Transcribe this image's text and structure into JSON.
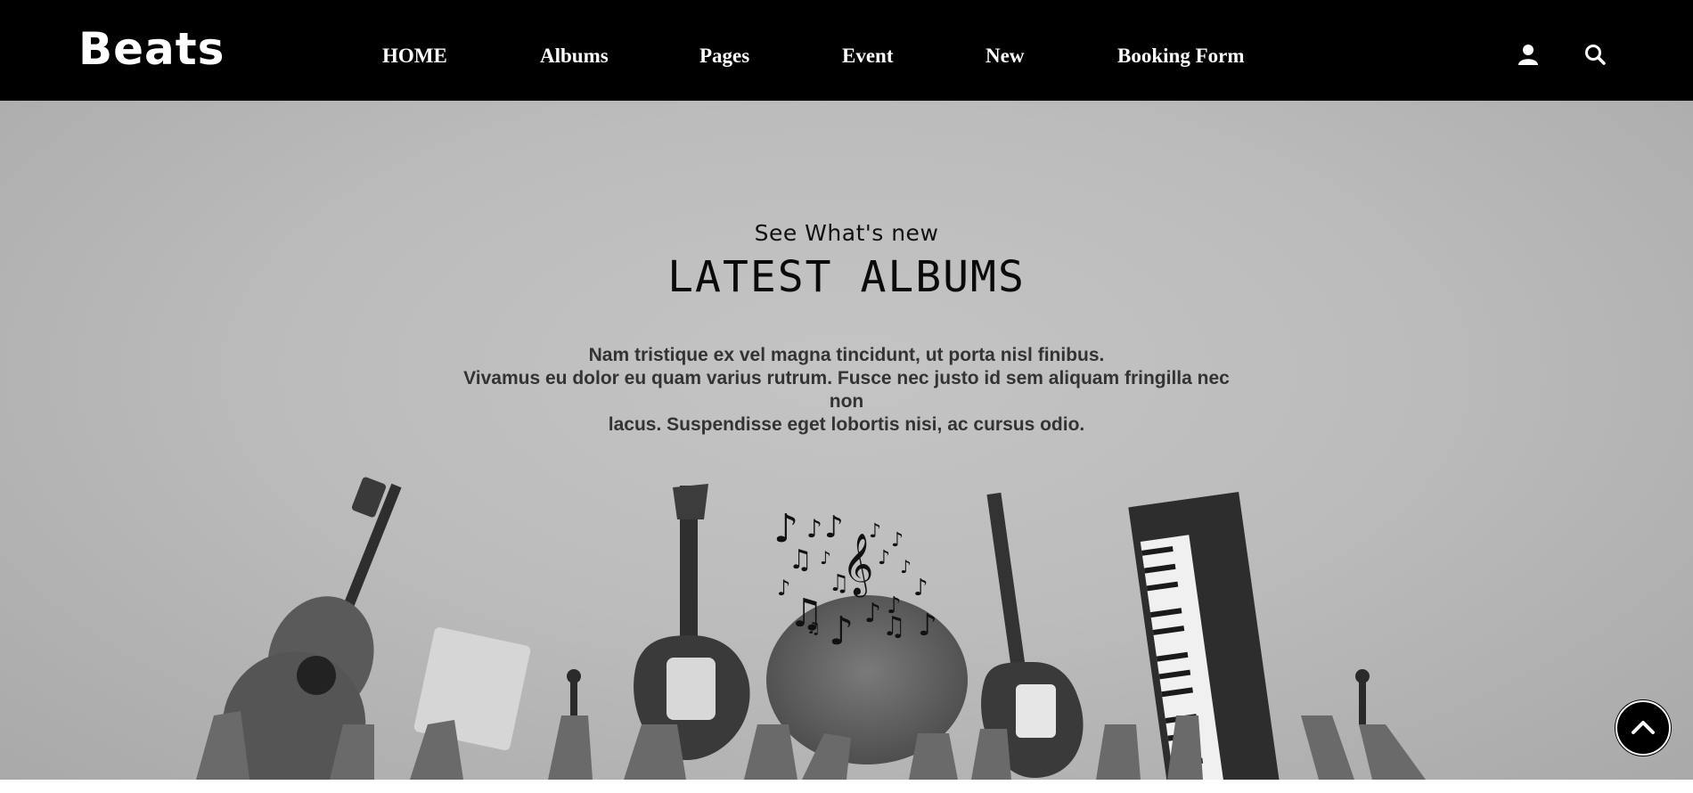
{
  "brand": {
    "name": "Beats"
  },
  "nav": {
    "items": [
      {
        "label": "HOME"
      },
      {
        "label": "Albums"
      },
      {
        "label": "Pages"
      },
      {
        "label": "Event"
      },
      {
        "label": "New"
      },
      {
        "label": "Booking Form"
      }
    ],
    "icons": {
      "user": "user-icon",
      "search": "search-icon"
    }
  },
  "hero": {
    "subtitle": "See What's new",
    "title": "LATEST ALBUMS",
    "description": [
      "Nam tristique ex vel magna tincidunt, ut porta nisl finibus.",
      "Vivamus eu dolor eu quam varius rutrum. Fusce nec justo id sem aliquam fringilla nec non",
      "lacus. Suspendisse eget lobortis nisi, ac cursus odio."
    ],
    "image": "hands-holding-instruments-grayscale",
    "overlay": "music-notes"
  },
  "scroll_top": {
    "icon": "chevron-up-icon"
  },
  "colors": {
    "navbar_bg": "#000000",
    "nav_text": "#ffffff",
    "hero_bg": "#bdbdbd",
    "title_text": "#0a0a0a",
    "body_text": "#333333"
  }
}
